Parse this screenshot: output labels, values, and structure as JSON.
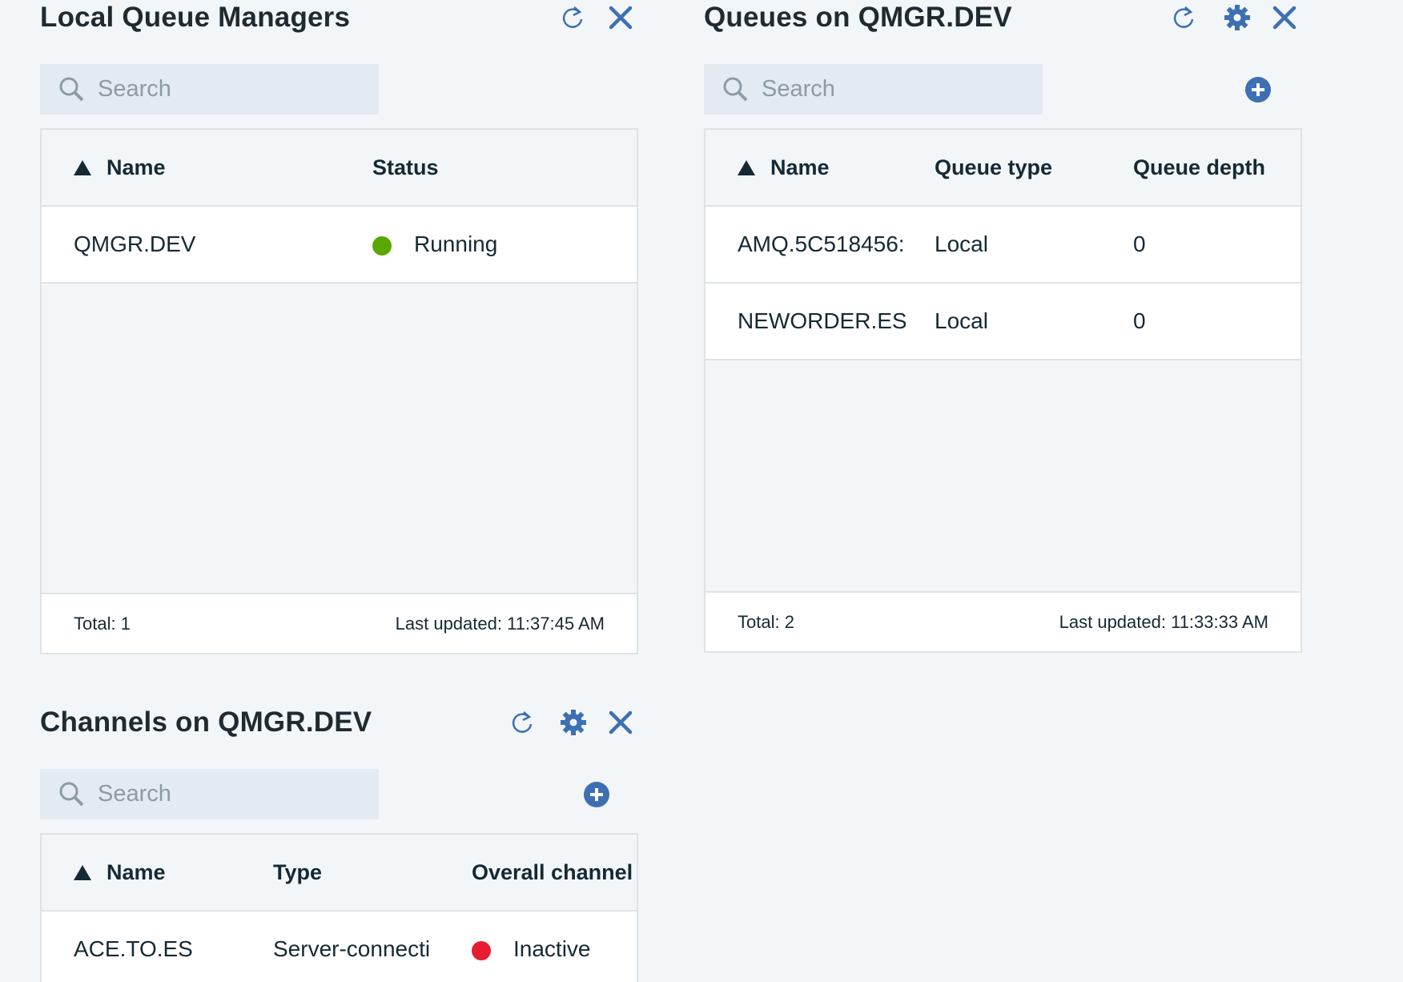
{
  "colors": {
    "accent": "#3d70b2",
    "running": "#5aa700",
    "inactive": "#e71d32"
  },
  "qmgr_widget": {
    "title": "Local Queue Managers",
    "search_placeholder": "Search",
    "columns": [
      "Name",
      "Status"
    ],
    "rows": [
      {
        "name": "QMGR.DEV",
        "status": "Running"
      }
    ],
    "total": "Total: 1",
    "last_updated": "Last updated: 11:37:45 AM"
  },
  "queues_widget": {
    "title": "Queues on QMGR.DEV",
    "search_placeholder": "Search",
    "columns": [
      "Name",
      "Queue type",
      "Queue depth"
    ],
    "rows": [
      {
        "name": "AMQ.5C518456:",
        "type": "Local",
        "depth": "0"
      },
      {
        "name": "NEWORDER.ES",
        "type": "Local",
        "depth": "0"
      }
    ],
    "total": "Total: 2",
    "last_updated": "Last updated: 11:33:33 AM"
  },
  "channels_widget": {
    "title": "Channels on QMGR.DEV",
    "search_placeholder": "Search",
    "columns": [
      "Name",
      "Type",
      "Overall channel"
    ],
    "rows": [
      {
        "name": "ACE.TO.ES",
        "type": "Server-connecti",
        "status": "Inactive"
      }
    ]
  },
  "icons": [
    "refresh-icon",
    "close-icon",
    "gear-icon",
    "search-icon",
    "add-icon",
    "sort-ascending-icon",
    "status-dot-icon"
  ]
}
